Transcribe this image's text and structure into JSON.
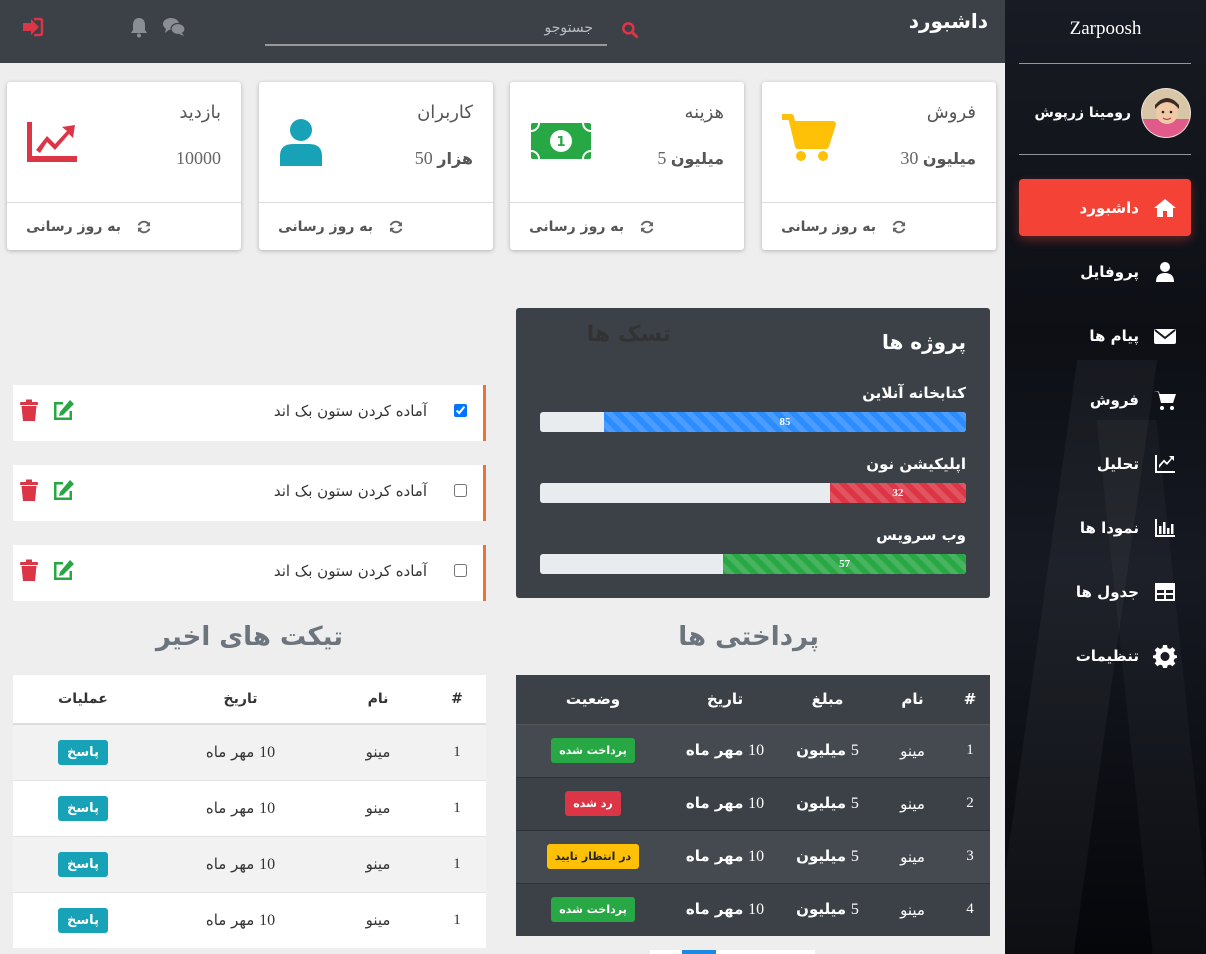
{
  "app": {
    "brand": "Zarpoosh",
    "title": "داشبورد"
  },
  "user": {
    "name": "رومینا زرپوش"
  },
  "search": {
    "placeholder": "جستوجو"
  },
  "sidebar": {
    "items": [
      {
        "label": "داشبورد",
        "icon": "home-icon",
        "active": true
      },
      {
        "label": "پروفایل",
        "icon": "user-icon"
      },
      {
        "label": "پیام ها",
        "icon": "envelope-icon"
      },
      {
        "label": "فروش",
        "icon": "cart-icon"
      },
      {
        "label": "تحلیل",
        "icon": "line-chart-icon"
      },
      {
        "label": "نمودا ها",
        "icon": "bar-chart-icon"
      },
      {
        "label": "جدول ها",
        "icon": "table-icon"
      },
      {
        "label": "تنظیمات",
        "icon": "gear-icon"
      }
    ]
  },
  "stats": [
    {
      "title": "فروش",
      "value": "30",
      "unit": "میلیون",
      "icon": "cart-icon",
      "color": "#ffc107",
      "footer": "به روز رسانی"
    },
    {
      "title": "هزینه",
      "value": "5",
      "unit": "میلیون",
      "icon": "money-icon",
      "color": "#28a745",
      "footer": "به روز رسانی"
    },
    {
      "title": "کاربران",
      "value": "50",
      "unit": "هزار",
      "icon": "user-icon",
      "color": "#17a2b8",
      "footer": "به روز رسانی"
    },
    {
      "title": "بازدید",
      "value": "10000",
      "unit": "",
      "icon": "line-chart-icon",
      "color": "#dc3545",
      "footer": "به روز رسانی"
    }
  ],
  "projects": {
    "title": "پروژه ها",
    "items": [
      {
        "name": "کتابخانه آنلاین",
        "progress": 85,
        "label": "85",
        "color": "#2b8cff"
      },
      {
        "name": "اپلیکیشن نون",
        "progress": 32,
        "label": "32",
        "color": "#dc3545"
      },
      {
        "name": "وب سرویس",
        "progress": 57,
        "label": "57",
        "color": "#28a745"
      }
    ]
  },
  "tasks": {
    "title": "تسک ها",
    "items": [
      {
        "text": "آماده کردن ستون بک اند",
        "checked": true
      },
      {
        "text": "آماده کردن ستون بک اند",
        "checked": false
      },
      {
        "text": "آماده کردن ستون بک اند",
        "checked": false
      }
    ]
  },
  "payments": {
    "title": "پرداختی ها",
    "headers": [
      "#",
      "نام",
      "مبلغ",
      "تاریخ",
      "وضعیت"
    ],
    "rows": [
      {
        "id": "1",
        "name": "مینو",
        "amount": "5",
        "amount_unit": "میلیون",
        "date": "10",
        "date_text": "مهر ماه",
        "status": "پرداخت شده",
        "status_type": "green"
      },
      {
        "id": "2",
        "name": "مینو",
        "amount": "5",
        "amount_unit": "میلیون",
        "date": "10",
        "date_text": "مهر ماه",
        "status": "رد شده",
        "status_type": "red"
      },
      {
        "id": "3",
        "name": "مینو",
        "amount": "5",
        "amount_unit": "میلیون",
        "date": "10",
        "date_text": "مهر ماه",
        "status": "در انتظار تایید",
        "status_type": "yellow"
      },
      {
        "id": "4",
        "name": "مینو",
        "amount": "5",
        "amount_unit": "میلیون",
        "date": "10",
        "date_text": "مهر ماه",
        "status": "پرداخت شده",
        "status_type": "green"
      }
    ]
  },
  "tickets": {
    "title": "تیکت های اخیر",
    "headers": [
      "#",
      "نام",
      "تاریخ",
      "عملیات"
    ],
    "rows": [
      {
        "id": "1",
        "name": "مینو",
        "date": "10",
        "date_text": "مهر ماه",
        "action": "پاسخ"
      },
      {
        "id": "1",
        "name": "مینو",
        "date": "10",
        "date_text": "مهر ماه",
        "action": "پاسخ"
      },
      {
        "id": "1",
        "name": "مینو",
        "date": "10",
        "date_text": "مهر ماه",
        "action": "پاسخ"
      },
      {
        "id": "1",
        "name": "مینو",
        "date": "10",
        "date_text": "مهر ماه",
        "action": "پاسخ"
      }
    ]
  }
}
